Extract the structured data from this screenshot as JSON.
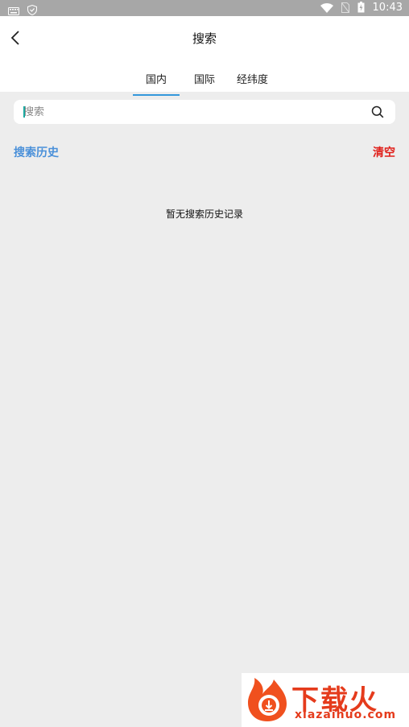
{
  "status_bar": {
    "time": "10:43",
    "icons": [
      "keyboard-icon",
      "shield-icon",
      "wifi-icon",
      "no-sim-icon",
      "battery-charging-icon"
    ]
  },
  "header": {
    "title": "搜索",
    "tabs": [
      {
        "label": "国内",
        "active": true
      },
      {
        "label": "国际",
        "active": false
      },
      {
        "label": "经纬度",
        "active": false
      }
    ]
  },
  "search": {
    "placeholder": "搜索",
    "value": ""
  },
  "history": {
    "title": "搜索历史",
    "clear_label": "清空",
    "empty_text": "暂无搜索历史记录"
  },
  "watermark": {
    "main": "下载火",
    "sub": "xiazaihuo.com"
  },
  "colors": {
    "accent": "#3498db",
    "history_title": "#4a90d9",
    "clear": "#e0201b",
    "background": "#ededed"
  }
}
